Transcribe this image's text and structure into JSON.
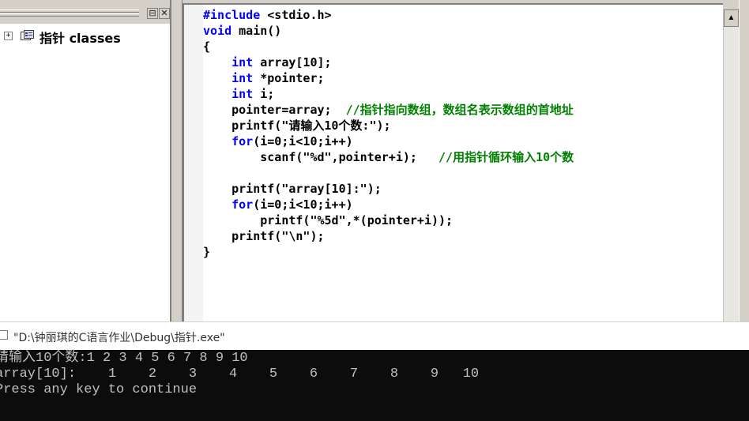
{
  "workspace": {
    "tree": {
      "expander": "+",
      "label": "指针 classes"
    },
    "buttons": {
      "restore": "⊟",
      "close": "✕"
    }
  },
  "editor": {
    "language": "C",
    "lines": [
      [
        {
          "t": "kw",
          "v": "#include"
        },
        {
          "t": "tx",
          "v": " <stdio.h>"
        }
      ],
      [
        {
          "t": "kw",
          "v": "void"
        },
        {
          "t": "tx",
          "v": " main()"
        }
      ],
      [
        {
          "t": "tx",
          "v": "{"
        }
      ],
      [
        {
          "t": "tx",
          "v": "    "
        },
        {
          "t": "kw",
          "v": "int"
        },
        {
          "t": "tx",
          "v": " array[10];"
        }
      ],
      [
        {
          "t": "tx",
          "v": "    "
        },
        {
          "t": "kw",
          "v": "int"
        },
        {
          "t": "tx",
          "v": " *pointer;"
        }
      ],
      [
        {
          "t": "tx",
          "v": "    "
        },
        {
          "t": "kw",
          "v": "int"
        },
        {
          "t": "tx",
          "v": " i;"
        }
      ],
      [
        {
          "t": "tx",
          "v": "    pointer=array;  "
        },
        {
          "t": "cm",
          "v": "//指针指向数组，数组名表示数组的首地址"
        }
      ],
      [
        {
          "t": "tx",
          "v": "    printf(\"请输入10个数:\");"
        }
      ],
      [
        {
          "t": "tx",
          "v": "    "
        },
        {
          "t": "kw",
          "v": "for"
        },
        {
          "t": "tx",
          "v": "(i=0;i<10;i++)"
        }
      ],
      [
        {
          "t": "tx",
          "v": "        scanf(\"%d\",pointer+i);   "
        },
        {
          "t": "cm",
          "v": "//用指针循环输入10个数"
        }
      ],
      [
        {
          "t": "tx",
          "v": ""
        }
      ],
      [
        {
          "t": "tx",
          "v": "    printf(\"array[10]:\");"
        }
      ],
      [
        {
          "t": "tx",
          "v": "    "
        },
        {
          "t": "kw",
          "v": "for"
        },
        {
          "t": "tx",
          "v": "(i=0;i<10;i++)"
        }
      ],
      [
        {
          "t": "tx",
          "v": "        printf(\"%5d\",*(pointer+i));"
        }
      ],
      [
        {
          "t": "tx",
          "v": "    printf(\"\\n\");"
        }
      ],
      [
        {
          "t": "tx",
          "v": "}"
        }
      ]
    ]
  },
  "scrollbar": {
    "up_arrow": "▲"
  },
  "console": {
    "title": "\"D:\\钟丽琪的C语言作业\\Debug\\指针.exe\"",
    "lines": [
      "请输入10个数:1 2 3 4 5 6 7 8 9 10",
      "array[10]:    1    2    3    4    5    6    7    8    9   10",
      "Press any key to continue"
    ]
  },
  "colors": {
    "keyword": "#0000ff",
    "comment": "#008000",
    "console_bg": "#0c0c0c",
    "console_text": "#c0c0c0"
  }
}
